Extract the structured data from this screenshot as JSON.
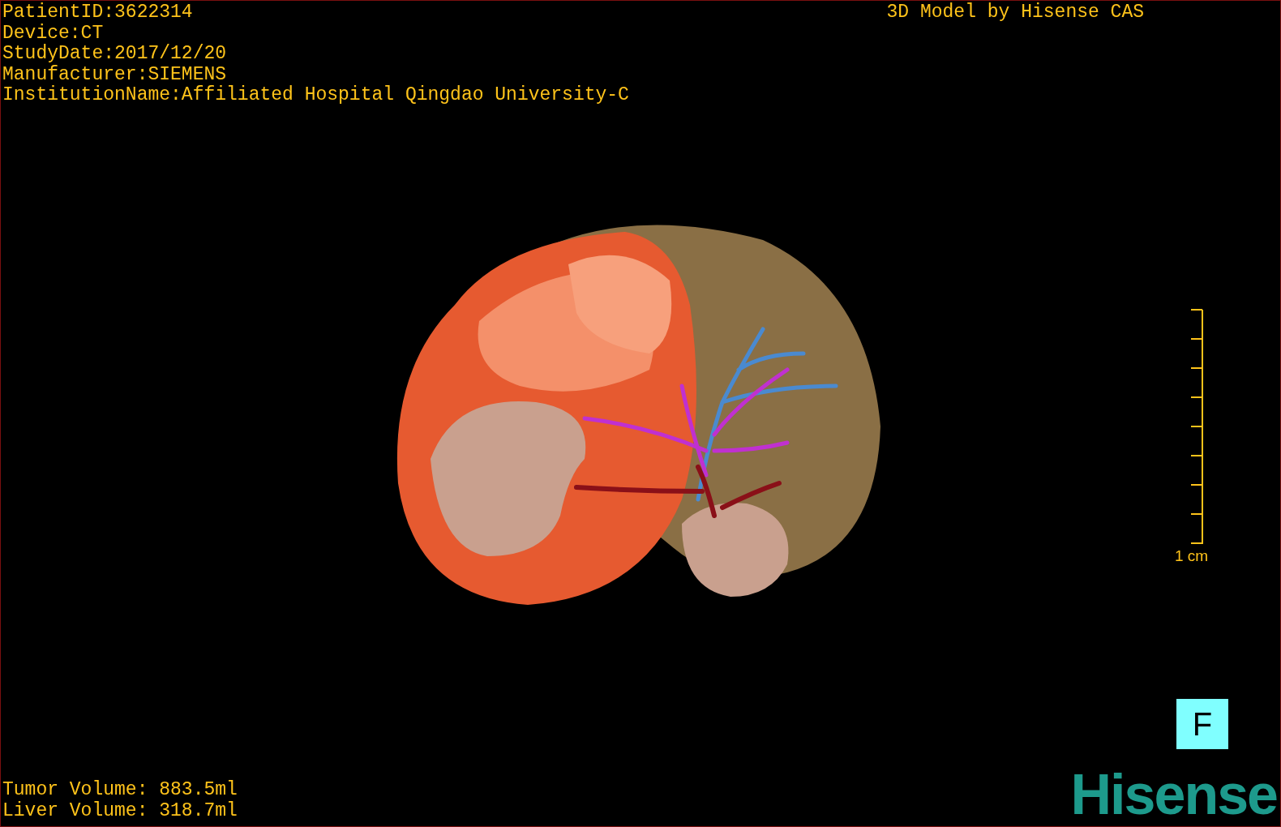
{
  "study_info": [
    "PatientID:3622314",
    "Device:CT",
    "StudyDate:2017/12/20",
    "Manufacturer:SIEMENS",
    "InstitutionName:Affiliated Hospital Qingdao University-C"
  ],
  "title": "3D Model by Hisense CAS",
  "scale_bar": {
    "label": "1 cm"
  },
  "view_button": {
    "label": "F"
  },
  "volumes": [
    "Tumor Volume: 883.5ml",
    "Liver Volume: 318.7ml"
  ],
  "logo": "Hisense"
}
